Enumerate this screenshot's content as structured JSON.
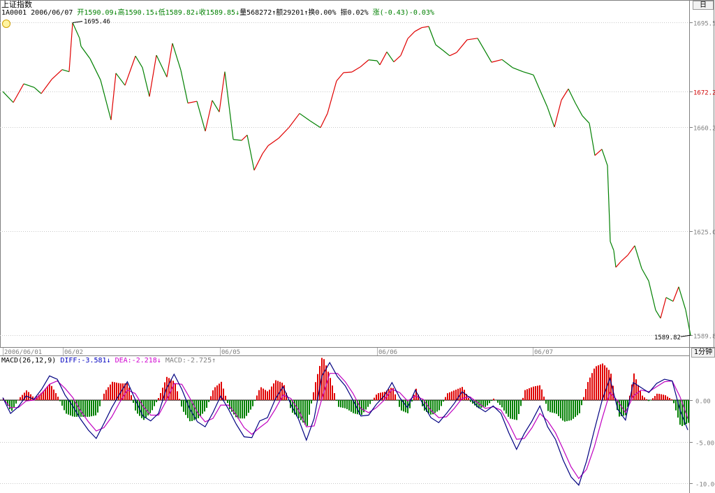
{
  "header": {
    "title": "上证指数",
    "code": "1A0001",
    "date": "2006/06/07",
    "open": "开1590.09↓",
    "high": "高1590.15↓",
    "low": "低1589.82↓",
    "close": "收1589.85↓",
    "volume": "量568272↑",
    "amount": "额29201↑",
    "turnover": "换0.00%",
    "amplitude": "振0.02%",
    "change": "涨(-0.43)-0.03%"
  },
  "toolbar": {
    "day_button_label": "日",
    "period_button_label": "1分钟"
  },
  "macd_header": {
    "name": "MACD(26,12,9)",
    "diff": "DIFF:-3.581↓",
    "dea": "DEA:-2.218↓",
    "macd": "MACD:-2.725↑"
  },
  "colors": {
    "up": "#e00000",
    "down": "#008000",
    "diff_line": "#000080",
    "dea_line": "#c000c0",
    "grid": "#c8c8c8",
    "marker": "#d00000"
  },
  "chart_data": [
    {
      "type": "line",
      "panel": "price",
      "series": [
        {
          "x_index": [
            0,
            15,
            30,
            45,
            55,
            70,
            85,
            95,
            100,
            110,
            112,
            125,
            140,
            155,
            162,
            175,
            190,
            200,
            210,
            220,
            235,
            243,
            255,
            265,
            278,
            290,
            300,
            310,
            318,
            330,
            342,
            350,
            360,
            372,
            380,
            395,
            410,
            425,
            440,
            455,
            465,
            478,
            488,
            500,
            512,
            524,
            536,
            540,
            550,
            560,
            570,
            580,
            590,
            600,
            610,
            620,
            630,
            640,
            650,
            665,
            680,
            700,
            715,
            730,
            745,
            760,
            770,
            780,
            790,
            800,
            810,
            820,
            830,
            840,
            848,
            858,
            866,
            870,
            875,
            878,
            885,
            895,
            905,
            915,
            925,
            935,
            942,
            950,
            960,
            968,
            978,
            985
          ],
          "values": [
            1672.2,
            1668.5,
            1674.8,
            1673.6,
            1671.5,
            1676.3,
            1679.6,
            1678.9,
            1695.46,
            1690.2,
            1687.5,
            1683.3,
            1676.1,
            1662.6,
            1678.4,
            1674.3,
            1684.2,
            1680.3,
            1670.5,
            1684.5,
            1677.1,
            1688.5,
            1679.4,
            1668.3,
            1668.9,
            1658.8,
            1669.2,
            1665.3,
            1678.9,
            1656.0,
            1655.7,
            1657.5,
            1645.6,
            1651.2,
            1653.9,
            1656.4,
            1660.1,
            1664.8,
            1662.3,
            1660.0,
            1664.8,
            1675.8,
            1678.6,
            1678.8,
            1680.5,
            1682.9,
            1682.6,
            1681.2,
            1685.6,
            1682.2,
            1684.4,
            1690.1,
            1692.5,
            1693.8,
            1694.2,
            1688.0,
            1686.2,
            1684.3,
            1685.4,
            1689.7,
            1690.2,
            1682.1,
            1683.0,
            1680.3,
            1678.9,
            1677.8,
            1672.3,
            1666.9,
            1660.2,
            1669.3,
            1673.1,
            1668.3,
            1664.0,
            1661.5,
            1650.6,
            1652.7,
            1647.2,
            1621.5,
            1618.5,
            1612.8,
            1614.7,
            1616.9,
            1620.1,
            1612.4,
            1608.2,
            1598.3,
            1595.6,
            1602.6,
            1601.3,
            1606.2,
            1598.4,
            1589.82
          ]
        }
      ],
      "ylim": [
        1587.5,
        1697.0
      ],
      "y_ticks": [
        "1695.5",
        "1672.2",
        "1660.2",
        "1625.0",
        "1589.8"
      ],
      "x_ticks": [
        "2006/06/01",
        "06/02",
        "06/05",
        "06/06",
        "06/07"
      ],
      "annotations": [
        "1695.46",
        "1589.82"
      ]
    },
    {
      "type": "bar",
      "panel": "macd",
      "series": [
        {
          "name": "DIFF",
          "values": [
            0.3,
            -1.6,
            -0.8,
            0.5,
            0.1,
            1.3,
            2.9,
            2.5,
            0.6,
            -0.7,
            -2.3,
            -3.6,
            -4.6,
            -2.8,
            -0.9,
            0.7,
            2.2,
            0.1,
            -1.9,
            -2.5,
            -1.6,
            1.3,
            3.1,
            1.3,
            -1.0,
            -2.6,
            -3.2,
            -1.5,
            0.5,
            -1.1,
            -2.9,
            -4.4,
            -4.5,
            -2.5,
            -2.1,
            0.1,
            1.6,
            -0.5,
            -2.3,
            -4.8,
            -2.2,
            2.9,
            4.5,
            2.8,
            1.7,
            0.0,
            -1.9,
            -1.8,
            -0.5,
            0.5,
            2.1,
            0.3,
            -0.9,
            1.2,
            -0.5,
            -2.1,
            -2.7,
            -1.6,
            -0.4,
            1.0,
            0.3,
            -0.8,
            -1.4,
            -0.7,
            -1.6,
            -3.9,
            -5.9,
            -4.0,
            -2.5,
            -0.7,
            -3.2,
            -4.7,
            -7.2,
            -9.2,
            -10.2,
            -7.3,
            -3.6,
            0.0,
            2.6,
            -1.1,
            -2.4,
            2.1,
            1.5,
            0.9,
            2.0,
            2.5,
            2.3,
            -1.2,
            -3.581
          ]
        },
        {
          "name": "DEA",
          "values": [
            0.2,
            -0.9,
            -0.9,
            -0.1,
            0.0,
            0.8,
            1.9,
            2.3,
            1.4,
            0.3,
            -1.3,
            -2.6,
            -3.7,
            -3.3,
            -2.0,
            -0.3,
            1.2,
            0.8,
            -0.7,
            -1.8,
            -1.8,
            -0.1,
            2.0,
            1.9,
            0.3,
            -1.5,
            -2.6,
            -2.2,
            -0.6,
            -0.6,
            -1.8,
            -3.3,
            -4.1,
            -3.3,
            -2.6,
            -1.1,
            0.6,
            0.2,
            -1.2,
            -3.2,
            -3.1,
            0.2,
            3.2,
            3.2,
            2.2,
            0.8,
            -1.0,
            -1.5,
            -0.9,
            0.0,
            1.3,
            0.9,
            -0.1,
            0.5,
            0.1,
            -1.2,
            -2.1,
            -2.0,
            -1.0,
            0.2,
            0.4,
            -0.3,
            -1.0,
            -0.8,
            -1.2,
            -2.8,
            -4.7,
            -4.6,
            -3.3,
            -1.6,
            -2.5,
            -3.9,
            -5.9,
            -8.0,
            -9.4,
            -8.3,
            -5.6,
            -2.2,
            0.9,
            -0.1,
            -1.5,
            0.5,
            1.2,
            1.0,
            1.6,
            2.2,
            2.3,
            0.4,
            -2.218
          ]
        },
        {
          "name": "MACD",
          "values": [
            0.2,
            -1.4,
            0.2,
            1.2,
            0.2,
            1.0,
            2.0,
            0.4,
            -1.6,
            -2.0,
            -2.0,
            -2.0,
            -1.8,
            1.0,
            2.2,
            2.0,
            2.0,
            -1.4,
            -2.4,
            -1.4,
            0.4,
            2.8,
            2.2,
            -1.2,
            -2.6,
            -2.2,
            -1.2,
            1.4,
            2.2,
            -1.0,
            -2.2,
            -2.2,
            -0.8,
            1.6,
            1.0,
            2.4,
            2.0,
            -1.4,
            -2.2,
            -3.2,
            1.8,
            5.4,
            2.6,
            -0.8,
            -1.0,
            -1.6,
            -1.8,
            -0.6,
            0.8,
            1.0,
            1.6,
            -1.2,
            -1.6,
            1.4,
            -1.2,
            -1.8,
            -1.2,
            0.8,
            1.2,
            1.6,
            -0.2,
            -1.0,
            -0.8,
            0.2,
            -0.8,
            -2.2,
            -2.4,
            1.2,
            1.6,
            1.8,
            -1.4,
            -1.6,
            -2.6,
            -2.4,
            -1.6,
            2.0,
            4.0,
            4.4,
            3.4,
            -2.0,
            -1.8,
            3.2,
            0.6,
            -0.2,
            0.8,
            0.6,
            0.0,
            -3.2,
            -2.725
          ]
        }
      ],
      "ylim": [
        -10.8,
        4.6
      ],
      "y_ticks": [
        "0.00",
        "-5.00",
        "-10.00"
      ]
    }
  ]
}
